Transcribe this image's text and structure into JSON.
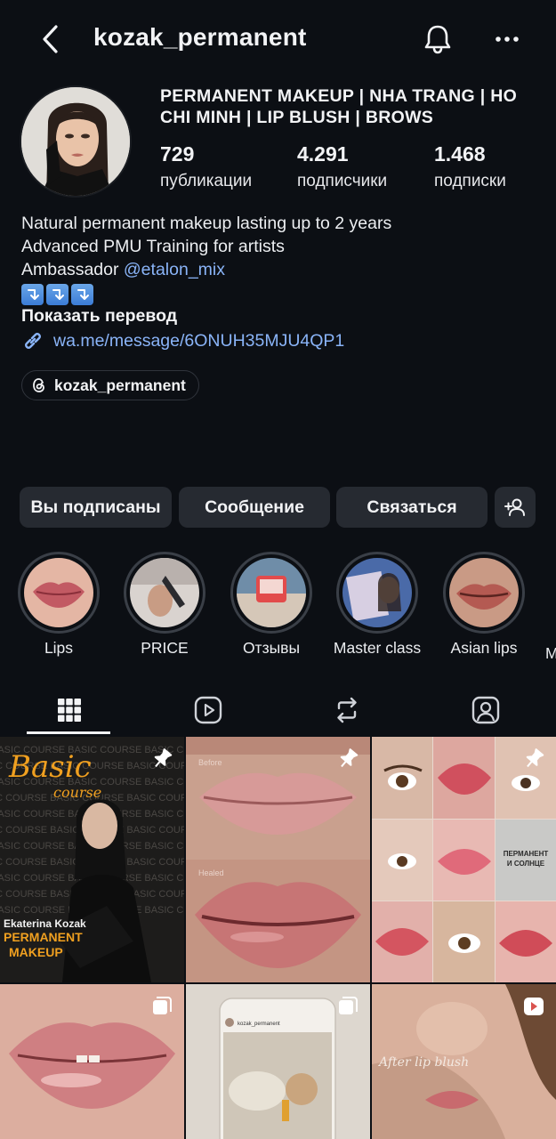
{
  "header": {
    "username": "kozak_permanent",
    "back_icon": "chevron-left-icon",
    "bell_icon": "bell-icon",
    "more_icon": "more-icon"
  },
  "profile": {
    "display_name": "PERMANENT MAKEUP | NHA TRANG | HO CHI MINH | LIP BLUSH | BROWS",
    "stats": [
      {
        "value": "729",
        "label": "публикации"
      },
      {
        "value": "4.291",
        "label": "подписчики"
      },
      {
        "value": "1.468",
        "label": "подписки"
      }
    ]
  },
  "bio": {
    "line1": "Natural permanent makeup lasting up to 2 years",
    "line2": "Advanced PMU Training for artists",
    "line3_prefix": "Ambassador ",
    "line3_mention": "@etalon_mix",
    "show_translation": "Показать перевод",
    "link": "wa.me/message/6ONUH35MJU4QP1",
    "threads_handle": "kozak_permanent"
  },
  "actions": {
    "following": "Вы подписаны",
    "message": "Сообщение",
    "contact": "Связаться",
    "add_person_icon": "add-person-icon"
  },
  "highlights": [
    {
      "label": "Lips"
    },
    {
      "label": "PRICE"
    },
    {
      "label": "Отзывы"
    },
    {
      "label": "Master class"
    },
    {
      "label": "Asian lips"
    },
    {
      "label": "M"
    }
  ],
  "tabs": [
    {
      "icon": "grid-icon",
      "selected": true
    },
    {
      "icon": "reels-icon",
      "selected": false
    },
    {
      "icon": "reposts-icon",
      "selected": false
    },
    {
      "icon": "tagged-icon",
      "selected": false
    }
  ],
  "posts": {
    "post1": {
      "script_title": "Basic",
      "script_sub": "course",
      "pattern_text": "BASIC COURSE BASIC COURSE BASIC COURS",
      "author": "Ekaterina Kozak",
      "headline1": "PERMANENT",
      "headline2": "MAKEUP"
    },
    "post2": {
      "label_top": "Before",
      "label_bottom": "Healed"
    },
    "post3": {
      "text_line1": "ПЕРМАНЕНТ",
      "text_line2": "И СОЛНЦЕ"
    },
    "post5": {
      "username": "kozak_permanent"
    },
    "post6": {
      "caption": "After lip blush"
    }
  },
  "colors": {
    "background": "#0c0f14",
    "button_bg": "#262a31",
    "link": "#8ab4f8",
    "orange_accent": "#f0a020"
  }
}
